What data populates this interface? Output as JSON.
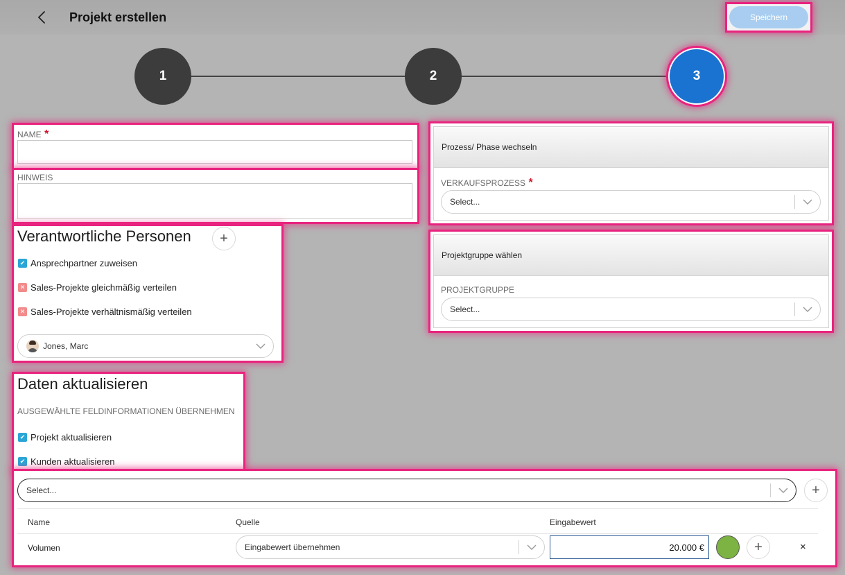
{
  "header": {
    "title": "Projekt erstellen",
    "save_label": "Speichern"
  },
  "stepper": {
    "steps": [
      "1",
      "2",
      "3"
    ],
    "active_step": 3
  },
  "form": {
    "name_label": "NAME",
    "name_value": "",
    "required_mark": "*",
    "hint_label": "HINWEIS",
    "hint_value": ""
  },
  "responsible": {
    "title": "Verantwortliche Personen",
    "add_label": "+",
    "options": [
      {
        "label": "Ansprechpartner zuweisen",
        "checked": true
      },
      {
        "label": "Sales-Projekte gleichmäßig verteilen",
        "checked": false
      },
      {
        "label": "Sales-Projekte verhältnismäßig verteilen",
        "checked": false
      }
    ],
    "person": "Jones, Marc"
  },
  "update": {
    "title": "Daten aktualisieren",
    "subtitle": "AUSGEWÄHLTE FELDINFORMATIONEN ÜBERNEHMEN",
    "options": [
      {
        "label": "Projekt aktualisieren",
        "checked": true
      },
      {
        "label": "Kunden aktualisieren",
        "checked": true
      }
    ]
  },
  "process_card": {
    "title": "Prozess/ Phase wechseln",
    "field_label": "VERKAUFSPROZESS",
    "placeholder": "Select..."
  },
  "group_card": {
    "title": "Projektgruppe wählen",
    "field_label": "PROJEKTGRUPPE",
    "placeholder": "Select..."
  },
  "field_table": {
    "select_placeholder": "Select...",
    "add_label": "+",
    "columns": [
      "Name",
      "Quelle",
      "Eingabewert"
    ],
    "rows": [
      {
        "name": "Volumen",
        "source": "Eingabewert übernehmen",
        "value": "20.000 €",
        "color": "#7cb342"
      }
    ],
    "remove_label": "×"
  },
  "colors": {
    "accent": "#1a73d0",
    "highlight": "#e8247e",
    "save_button": "#a8cdf0"
  }
}
